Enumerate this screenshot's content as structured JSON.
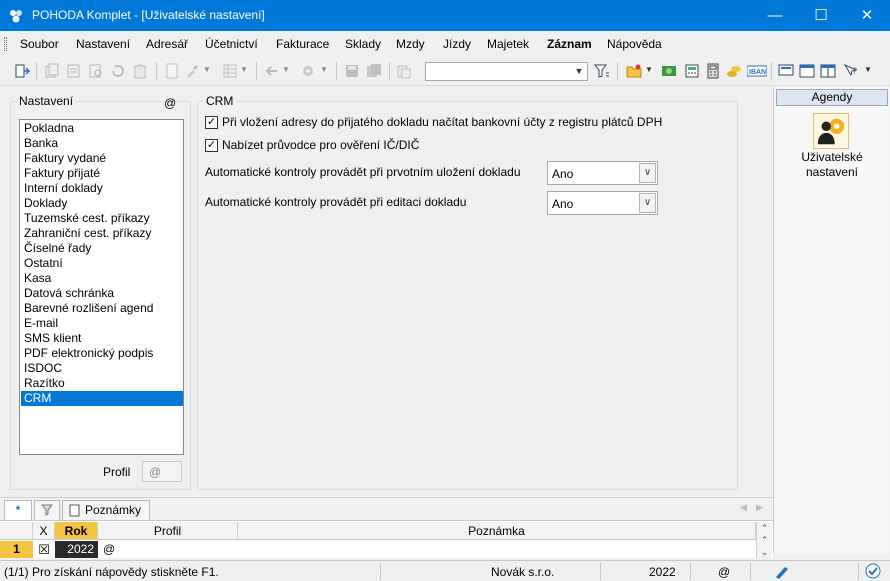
{
  "window": {
    "title": "POHODA Komplet - [Uživatelské nastavení]",
    "minimize": "—",
    "maximize": "☐",
    "close": "✕"
  },
  "menu": [
    "Soubor",
    "Nastavení",
    "Adresář",
    "Účetnictví",
    "Fakturace",
    "Sklady",
    "Mzdy",
    "Jízdy",
    "Majetek",
    "Záznam",
    "Nápověda"
  ],
  "toolbar": {
    "search_value": ""
  },
  "left": {
    "group_title": "Nastavení",
    "at_symbol": "@",
    "items": [
      "Pokladna",
      "Banka",
      "Faktury vydané",
      "Faktury přijaté",
      "Interní doklady",
      "Doklady",
      "Tuzemské cest. příkazy",
      "Zahraniční cest. příkazy",
      "Číselné řady",
      "Ostatní",
      "Kasa",
      "Datová schránka",
      "Barevné rozlišení agend",
      "E-mail",
      "SMS klient",
      "PDF elektronický podpis",
      "ISDOC",
      "Razítko",
      "CRM"
    ],
    "selected": "CRM",
    "profil_label": "Profil",
    "profil_value": "@"
  },
  "crm": {
    "title": "CRM",
    "checkbox1": "Při vložení adresy do přijatého dokladu načítat bankovní účty z registru plátců DPH",
    "checkbox2": "Nabízet průvodce pro ověření IČ/DIČ",
    "check_mark": "✓",
    "row1_label": "Automatické kontroly provádět při prvotním uložení dokladu",
    "row1_value": "Ano",
    "row2_label": "Automatické kontroly provádět při editaci dokladu",
    "row2_value": "Ano"
  },
  "agendy": {
    "header": "Agendy",
    "item_line1": "Uživatelské",
    "item_line2": "nastavení"
  },
  "tabs": {
    "star": "*",
    "notes": "Poznámky"
  },
  "grid": {
    "headers": {
      "x": "X",
      "rok": "Rok",
      "profil": "Profil",
      "poznamka": "Poznámka"
    },
    "row": {
      "num": "1",
      "x": "☒",
      "rok": "2022",
      "profil": "@"
    }
  },
  "status": {
    "help": "(1/1) Pro získání nápovědy stiskněte F1.",
    "company": "Novák s.r.o.",
    "year": "2022",
    "at": "@"
  }
}
